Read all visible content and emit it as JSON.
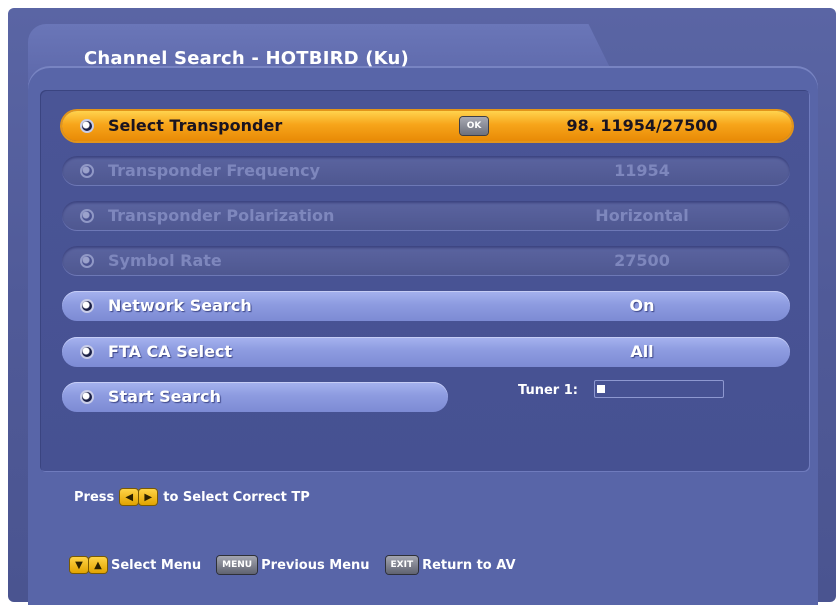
{
  "title": "Channel Search - HOTBIRD (Ku)",
  "rows": [
    {
      "label": "Select Transponder",
      "value": "98. 11954/27500",
      "ok_key": "OK"
    },
    {
      "label": "Transponder Frequency",
      "value": "11954"
    },
    {
      "label": "Transponder Polarization",
      "value": "Horizontal"
    },
    {
      "label": "Symbol Rate",
      "value": "27500"
    },
    {
      "label": "Network Search",
      "value": "On"
    },
    {
      "label": "FTA CA Select",
      "value": "All"
    },
    {
      "label": "Start Search"
    }
  ],
  "tuner": {
    "label": "Tuner 1:",
    "progress": 0.06
  },
  "hint": {
    "press": "Press",
    "left_key": "◀",
    "right_key": "▶",
    "text": "to Select Correct TP"
  },
  "footer": {
    "down_key": "▼",
    "up_key": "▲",
    "select_menu": "Select Menu",
    "menu_key": "MENU",
    "previous_menu": "Previous Menu",
    "exit_key": "EXIT",
    "return_av": "Return to AV"
  },
  "colors": {
    "background": "#505a98",
    "selected_row": "#f7a51a",
    "active_row": "#8d9be0",
    "disabled_row": "#4e5790"
  }
}
